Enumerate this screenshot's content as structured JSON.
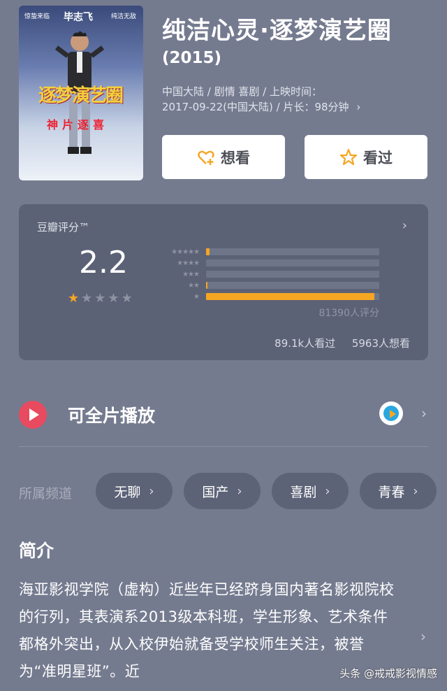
{
  "poster": {
    "top_left": "惊蛰来临",
    "top_center": "毕志飞",
    "top_right": "纯洁无敌",
    "logo_main": "逐梦演艺圈",
    "logo_sub": "神片逐喜"
  },
  "movie": {
    "title": "纯洁心灵·逐梦演艺圈",
    "year": "(2015)",
    "meta_line1": "中国大陆 / 剧情 喜剧 / 上映时间：",
    "meta_line2": "2017-09-22(中国大陆) / 片长：98分钟",
    "meta_chevron": "›"
  },
  "actions": {
    "want_label": "想看",
    "seen_label": "看过"
  },
  "rating": {
    "label": "豆瓣评分™",
    "score": "2.2",
    "stars_filled": 1,
    "stars_total": 5,
    "distribution": [
      {
        "stars": "★★★★★",
        "fraction": 0.02
      },
      {
        "stars": "★★★★",
        "fraction": 0.0
      },
      {
        "stars": "★★★",
        "fraction": 0.0
      },
      {
        "stars": "★★",
        "fraction": 0.01
      },
      {
        "stars": "★",
        "fraction": 0.97
      }
    ],
    "count": "81390人评分",
    "watched": "89.1k人看过",
    "want": "5963人想看"
  },
  "play": {
    "label": "可全片播放"
  },
  "channels": {
    "label": "所属频道",
    "items": [
      "无聊",
      "国产",
      "喜剧",
      "青春"
    ]
  },
  "intro": {
    "heading": "简介",
    "text": "海亚影视学院（虚构）近些年已经跻身国内著名影视院校的行列，其表演系2013级本科班，学生形象、艺术条件都格外突出，从入校伊始就备受学校师生关注，被誉为“准明星班”。近"
  },
  "watermark": "头条 @戒戒影视情感",
  "colors": {
    "background": "#757b8f",
    "card": "#5c6275",
    "accent": "#f5a623",
    "play": "#e84a5f"
  }
}
